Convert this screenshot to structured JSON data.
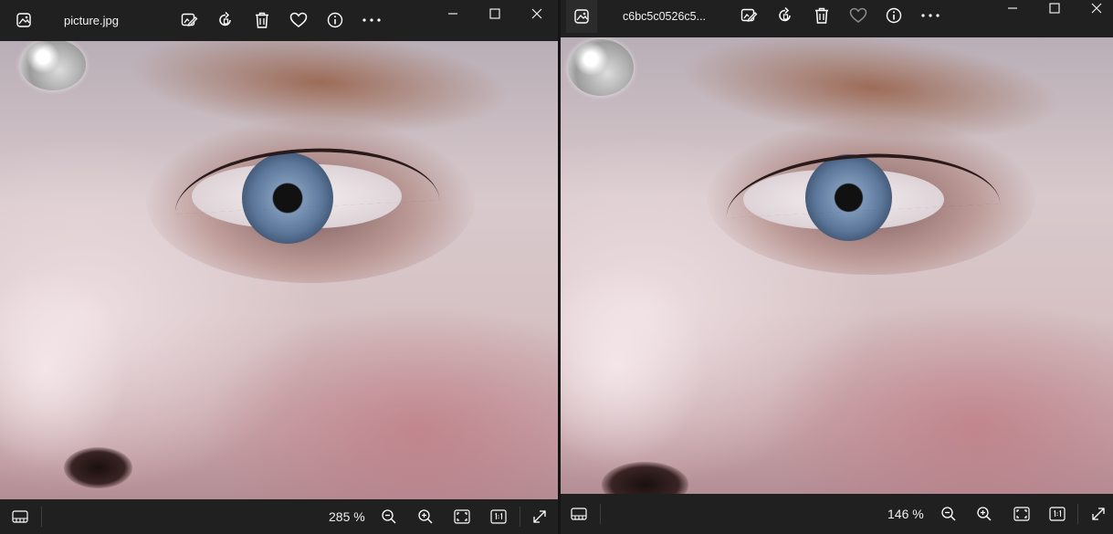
{
  "windows": [
    {
      "file_name": "picture.jpg",
      "zoom": "285 %",
      "favorite": true
    },
    {
      "file_name": "c6bc5c0526c5...",
      "zoom": "146 %",
      "favorite": false
    }
  ],
  "icons": {
    "app": "photos-app-icon",
    "edit": "edit-image-icon",
    "rotate": "rotate-icon",
    "delete": "trash-icon",
    "favorite": "heart-icon",
    "info": "info-icon",
    "more": "more-icon",
    "minimize": "minimize-icon",
    "maximize": "maximize-icon",
    "close": "close-icon",
    "filmstrip": "filmstrip-icon",
    "zoom_out": "zoom-out-icon",
    "zoom_in": "zoom-in-icon",
    "fit": "fit-to-window-icon",
    "actual_size": "actual-size-icon",
    "fullscreen": "fullscreen-icon"
  },
  "colors": {
    "chrome": "#202020",
    "icon": "#ffffff",
    "icon_dim": "#8a8a8a"
  }
}
